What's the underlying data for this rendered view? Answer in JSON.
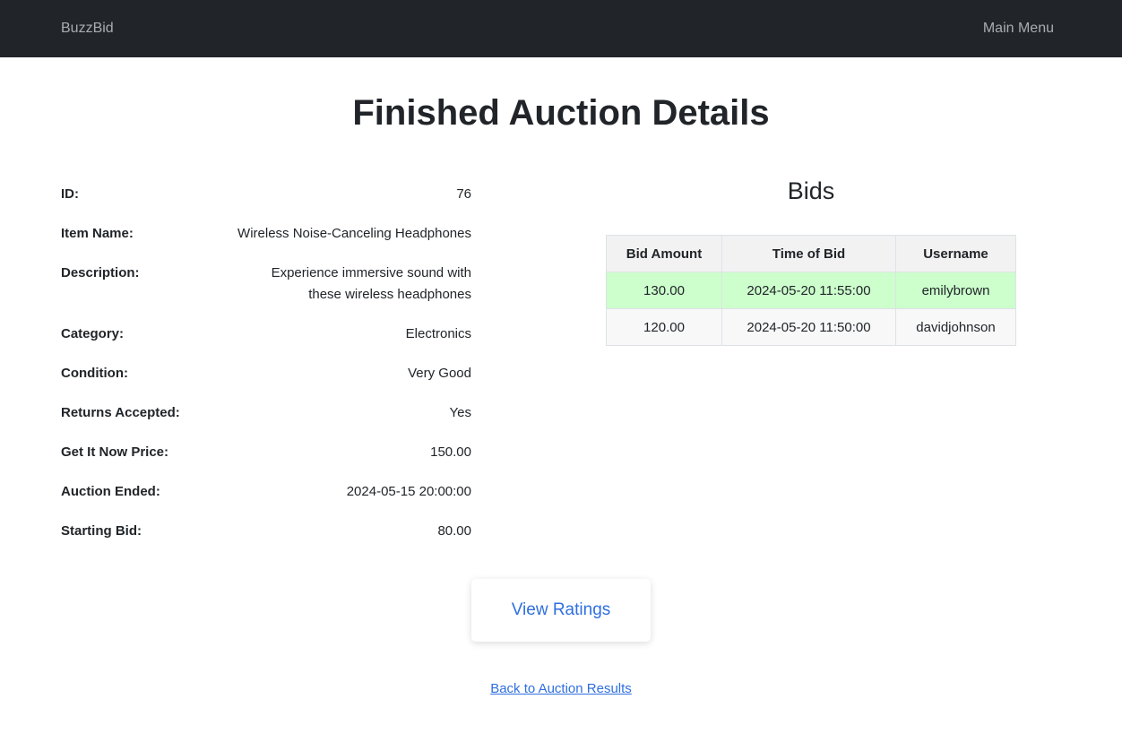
{
  "nav": {
    "brand": "BuzzBid",
    "main_menu": "Main Menu"
  },
  "page_title": "Finished Auction Details",
  "details": [
    {
      "label": "ID:",
      "value": "76"
    },
    {
      "label": "Item Name:",
      "value": "Wireless Noise-Canceling Headphones"
    },
    {
      "label": "Description:",
      "value": "Experience immersive sound with these wireless headphones"
    },
    {
      "label": "Category:",
      "value": "Electronics"
    },
    {
      "label": "Condition:",
      "value": "Very Good"
    },
    {
      "label": "Returns Accepted:",
      "value": "Yes"
    },
    {
      "label": "Get It Now Price:",
      "value": "150.00"
    },
    {
      "label": "Auction Ended:",
      "value": "2024-05-15 20:00:00"
    },
    {
      "label": "Starting Bid:",
      "value": "80.00"
    }
  ],
  "bids": {
    "title": "Bids",
    "headers": [
      "Bid Amount",
      "Time of Bid",
      "Username"
    ],
    "rows": [
      {
        "amount": "130.00",
        "time": "2024-05-20 11:55:00",
        "username": "emilybrown",
        "winner": true
      },
      {
        "amount": "120.00",
        "time": "2024-05-20 11:50:00",
        "username": "davidjohnson",
        "winner": false
      }
    ],
    "winner_color": "#ccffcc"
  },
  "actions": {
    "view_ratings": "View Ratings",
    "back_link": "Back to Auction Results"
  },
  "colors": {
    "navbar_bg": "#212529",
    "link": "#2f6fdf"
  }
}
